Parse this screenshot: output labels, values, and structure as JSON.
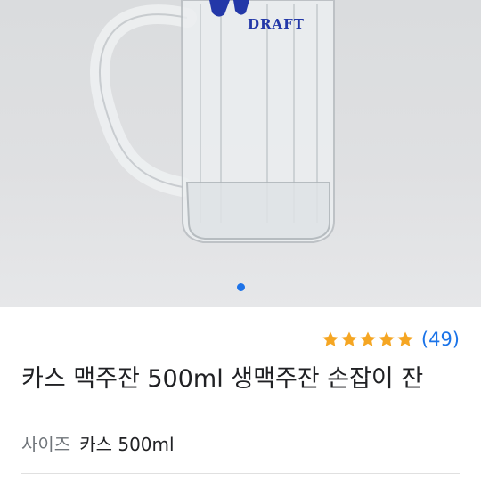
{
  "product": {
    "image_label": "DRAFT",
    "carousel": {
      "count": 1,
      "active_index": 0
    },
    "rating": {
      "stars": 5,
      "max_stars": 5,
      "review_count": "(49)"
    },
    "title": "카스 맥주잔 500ml 생맥주잔 손잡이 잔",
    "option": {
      "key": "사이즈",
      "value": "카스 500ml"
    }
  },
  "colors": {
    "accent": "#1a73e8",
    "star": "#f5a623"
  },
  "icons": {
    "star": "star-icon"
  }
}
